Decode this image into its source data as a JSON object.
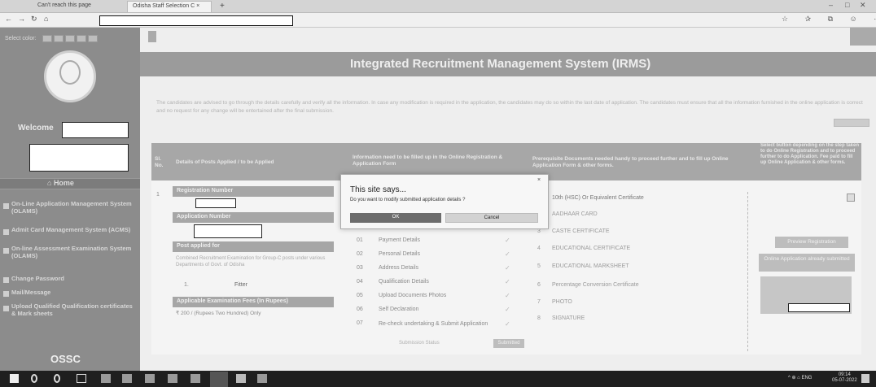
{
  "browser": {
    "tabs": [
      {
        "label": "Can't reach this page"
      },
      {
        "label": "Odisha Staff Selection C"
      }
    ],
    "new_tab": "+",
    "window_controls": {
      "minimize": "–",
      "maximize": "□",
      "close": "✕"
    },
    "nav": {
      "back": "←",
      "forward": "→",
      "refresh": "↻",
      "home": "⌂"
    },
    "toolbar_icons": "☆ ✰ ⧉ ☺ ⋯"
  },
  "sidebar": {
    "color_label": "Select color:",
    "welcome": "Welcome",
    "home": "Home",
    "items": [
      {
        "label": "On-Line Application Management System (OLAMS)"
      },
      {
        "label": "Admit Card Management System (ACMS)"
      },
      {
        "label": "On-line Assessment Examination System (OLAMS)"
      },
      {
        "label": "Change Password"
      },
      {
        "label": "Mail/Message"
      },
      {
        "label": "Upload Qualified Qualification certificates & Mark sheets"
      }
    ],
    "footer": "OSSC"
  },
  "header": {
    "title": "Integrated Recruitment Management System (IRMS)"
  },
  "notice": {
    "text": "The candidates are advised to go through the details carefully and verify all the information. In case any modification is required in the application, the candidates may do so within the last date of application. The candidates must ensure that all the information furnished in the online application is correct and no request for any change will be entertained after the final submission.",
    "print_label": "Print Form"
  },
  "table": {
    "headers": [
      "Sl. No.",
      "Details of Posts Applied / to be Applied",
      "Information need to be filled up in the Online Registration & Application Form",
      "Prerequisite Documents needed handy to proceed further and to fill up Online Application Form & other forms.",
      "Select button depending on the step taken to do Online Registration and to proceed further to do Application. Fee paid to fill up Online Application & other forms."
    ],
    "row_no": "1",
    "left": {
      "reg_label": "Registration Number",
      "app_label": "Application Number",
      "post_label": "Post applied for",
      "post_desc": "Combined Recruitment Examination for Group-C posts under various Departments of Govt. of Odisha",
      "post_index": "1.",
      "post_status": "Fitter",
      "fee_label": "Applicable Examination Fees (In Rupees)",
      "fee_value": "₹ 200 / (Rupees Two Hundred) Only"
    },
    "steps": [
      {
        "no": "01",
        "label": "Payment Details"
      },
      {
        "no": "02",
        "label": "Personal Details"
      },
      {
        "no": "03",
        "label": "Address Details"
      },
      {
        "no": "04",
        "label": "Qualification Details"
      },
      {
        "no": "05",
        "label": "Upload Documents Photos"
      },
      {
        "no": "06",
        "label": "Self Declaration"
      },
      {
        "no": "07",
        "label": "Re-check undertaking & Submit Application"
      }
    ],
    "submitted_caption": "Submission Status",
    "submitted_badge": "Submitted",
    "documents": [
      {
        "no": "1",
        "label": "10th (HSC) Or Equivalent Certificate"
      },
      {
        "no": "2",
        "label": "AADHAAR CARD"
      },
      {
        "no": "3",
        "label": "CASTE CERTIFICATE"
      },
      {
        "no": "4",
        "label": "EDUCATIONAL CERTIFICATE"
      },
      {
        "no": "5",
        "label": "EDUCATIONAL MARKSHEET"
      },
      {
        "no": "6",
        "label": "Percentage Conversion Certificate"
      },
      {
        "no": "7",
        "label": "PHOTO"
      },
      {
        "no": "8",
        "label": "SIGNATURE"
      }
    ],
    "actions": {
      "preview": "Preview Registration",
      "online_app": "Online Application already submitted"
    }
  },
  "dialog": {
    "title": "This site says...",
    "message": "Do you want to modify submitted application details ?",
    "ok": "OK",
    "cancel": "Cancel",
    "close": "×"
  },
  "taskbar": {
    "tray": "^ ⊕ ⌂ ENG",
    "time": "09:14",
    "date": "05-07-2022"
  }
}
